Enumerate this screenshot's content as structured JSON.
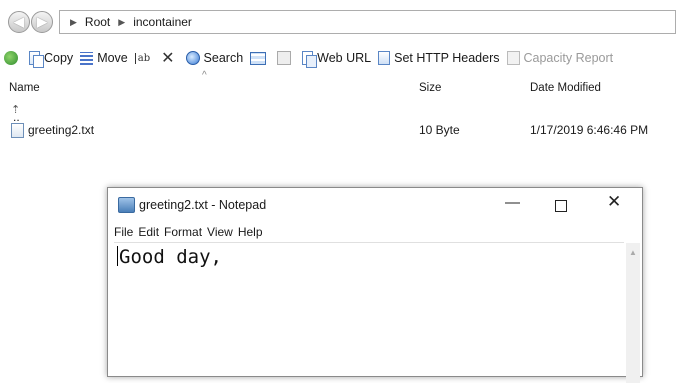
{
  "file_manager": {
    "breadcrumb": [
      "Root",
      "incontainer"
    ],
    "toolbar": {
      "copy": "Copy",
      "move": "Move",
      "search": "Search",
      "web_url": "Web URL",
      "set_http_headers": "Set HTTP Headers",
      "capacity_report": "Capacity Report"
    },
    "columns": {
      "name": "Name",
      "size": "Size",
      "date_modified": "Date Modified"
    },
    "parent_entry": "..",
    "files": [
      {
        "name": "greeting2.txt",
        "size": "10 Byte",
        "date_modified": "1/17/2019 6:46:46 PM"
      }
    ]
  },
  "notepad": {
    "title": "greeting2.txt - Notepad",
    "window_controls": {
      "minimize": "—",
      "close": "✕"
    },
    "menu": [
      "File",
      "Edit",
      "Format",
      "View",
      "Help"
    ],
    "content": "Good day,"
  }
}
